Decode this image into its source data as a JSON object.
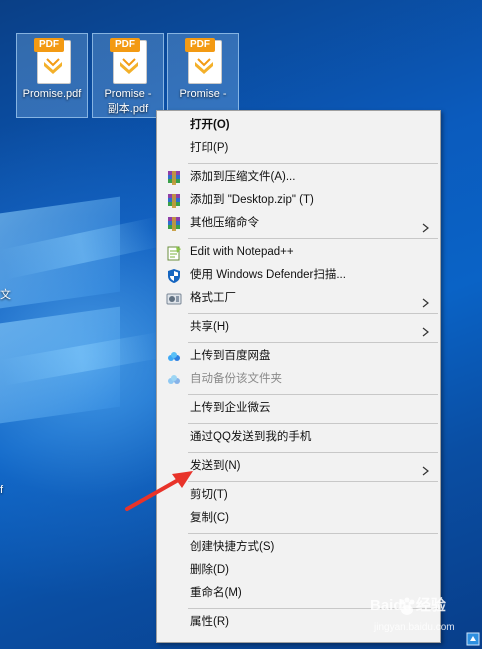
{
  "desktop": {
    "icons": [
      {
        "label_line1": "Promise.pdf",
        "label_line2": "",
        "file_tag": "PDF"
      },
      {
        "label_line1": "Promise -",
        "label_line2": "副本.pdf",
        "file_tag": "PDF"
      },
      {
        "label_line1": "Promise -",
        "label_line2": "",
        "file_tag": "PDF"
      }
    ],
    "edge_text_1": "文",
    "edge_text_2": "f"
  },
  "context_menu": {
    "groups": [
      [
        {
          "label": "打开(O)",
          "bold": true,
          "icon": null,
          "submenu": false
        },
        {
          "label": "打印(P)",
          "bold": false,
          "icon": null,
          "submenu": false
        }
      ],
      [
        {
          "label": "添加到压缩文件(A)...",
          "icon": "winrar-icon",
          "submenu": false
        },
        {
          "label": "添加到 \"Desktop.zip\" (T)",
          "icon": "winrar-icon",
          "submenu": false
        },
        {
          "label": "其他压缩命令",
          "icon": "winrar-icon",
          "submenu": true
        }
      ],
      [
        {
          "label": "Edit with Notepad++",
          "icon": "notepadpp-icon",
          "submenu": false
        },
        {
          "label": "使用 Windows Defender扫描...",
          "icon": "defender-shield-icon",
          "submenu": false
        },
        {
          "label": "格式工厂",
          "icon": "format-factory-icon",
          "submenu": true
        }
      ],
      [
        {
          "label": "共享(H)",
          "icon": null,
          "submenu": true
        }
      ],
      [
        {
          "label": "上传到百度网盘",
          "icon": "baidu-cloud-icon",
          "submenu": false
        },
        {
          "label": "自动备份该文件夹",
          "icon": "baidu-cloud-icon",
          "submenu": false,
          "disabled": true
        }
      ],
      [
        {
          "label": "上传到企业微云",
          "icon": null,
          "submenu": false
        }
      ],
      [
        {
          "label": "通过QQ发送到我的手机",
          "icon": null,
          "submenu": false
        }
      ],
      [
        {
          "label": "发送到(N)",
          "icon": null,
          "submenu": true
        }
      ],
      [
        {
          "label": "剪切(T)",
          "icon": null,
          "submenu": false
        },
        {
          "label": "复制(C)",
          "icon": null,
          "submenu": false
        }
      ],
      [
        {
          "label": "创建快捷方式(S)",
          "icon": null,
          "submenu": false
        },
        {
          "label": "删除(D)",
          "icon": null,
          "submenu": false
        },
        {
          "label": "重命名(M)",
          "icon": null,
          "submenu": false
        }
      ],
      [
        {
          "label": "属性(R)",
          "icon": null,
          "submenu": false
        }
      ]
    ]
  },
  "annotation": {
    "arrow_color": "#e8332a"
  },
  "watermark": {
    "text": "Baidu 经验",
    "sub": "jingyan.baidu.com"
  },
  "colors": {
    "menu_bg": "#f2f2f2",
    "pdf_tag": "#f39a13",
    "accent_blue": "#0a63c6"
  }
}
